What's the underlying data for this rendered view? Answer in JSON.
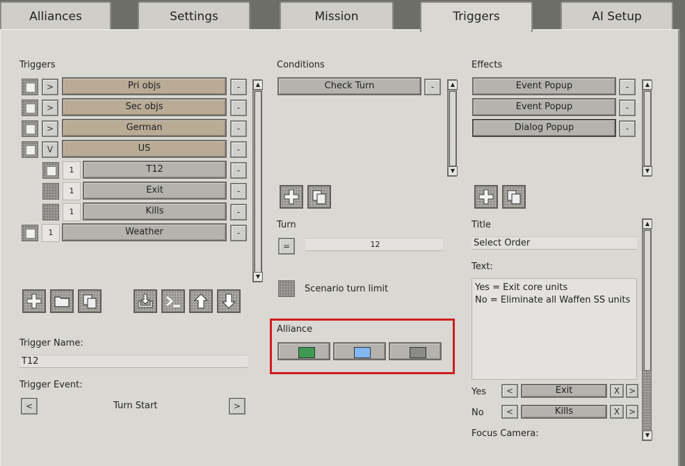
{
  "tabs": [
    "Alliances",
    "Settings",
    "Mission",
    "Triggers",
    "AI Setup"
  ],
  "active_tab": "Triggers",
  "triggers": {
    "label": "Triggers",
    "expand_labels": [
      ">",
      ">",
      ">",
      "V"
    ],
    "items": [
      "Pri objs",
      "Sec objs",
      "German",
      "US"
    ],
    "children": [
      {
        "num": "1",
        "label": "T12"
      },
      {
        "num": "1",
        "label": "Exit"
      },
      {
        "num": "1",
        "label": "Kills"
      }
    ],
    "weather": {
      "num": "1",
      "label": "Weather"
    },
    "remove_label": "-"
  },
  "trigger_name": {
    "label": "Trigger Name:",
    "value": "T12"
  },
  "trigger_event": {
    "label": "Trigger Event:",
    "value": "Turn Start",
    "prev": "<",
    "next": ">"
  },
  "conditions": {
    "label": "Conditions",
    "items": [
      "Check Turn"
    ],
    "remove_label": "-"
  },
  "turn": {
    "label": "Turn",
    "op": "=",
    "value": "12"
  },
  "scenario_turn_limit": "Scenario turn limit",
  "alliance": {
    "label": "Alliance",
    "colors": [
      "#3e9a50",
      "#84b6f2",
      "#8a8a87"
    ]
  },
  "effects": {
    "label": "Effects",
    "items": [
      "Event Popup",
      "Event Popup",
      "Dialog Popup"
    ],
    "remove_label": "-"
  },
  "title": {
    "label": "Title",
    "value": "Select Order"
  },
  "text": {
    "label": "Text:",
    "value": "Yes = Exit core units\nNo = Eliminate all Waffen SS units"
  },
  "yes": {
    "label": "Yes",
    "prev": "<",
    "value": "Exit",
    "clear": "X",
    "next": ">"
  },
  "no": {
    "label": "No",
    "prev": "<",
    "value": "Kills",
    "clear": "X",
    "next": ">"
  },
  "focus_camera": "Focus Camera:",
  "highlight_color": "#d01c1c"
}
